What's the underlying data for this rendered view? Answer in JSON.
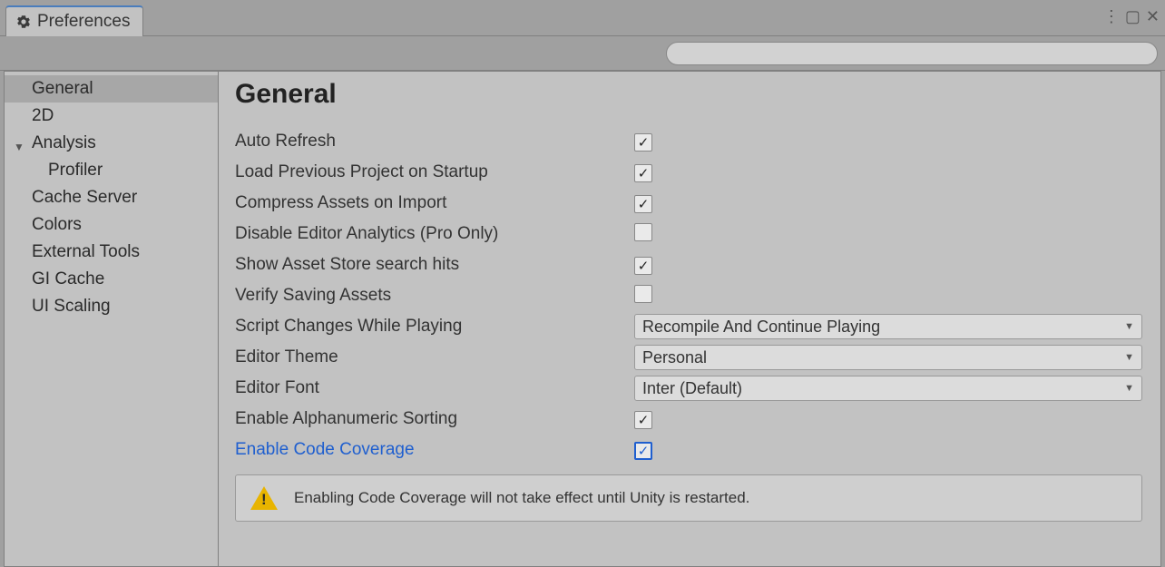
{
  "window": {
    "tab_title": "Preferences"
  },
  "sidebar": {
    "items": [
      {
        "label": "General",
        "selected": true
      },
      {
        "label": "2D"
      },
      {
        "label": "Analysis",
        "expandable": true
      },
      {
        "label": "Profiler",
        "child": true
      },
      {
        "label": "Cache Server"
      },
      {
        "label": "Colors"
      },
      {
        "label": "External Tools"
      },
      {
        "label": "GI Cache"
      },
      {
        "label": "UI Scaling"
      }
    ]
  },
  "content": {
    "heading": "General",
    "prefs": [
      {
        "label": "Auto Refresh",
        "type": "checkbox",
        "checked": true
      },
      {
        "label": "Load Previous Project on Startup",
        "type": "checkbox",
        "checked": true
      },
      {
        "label": "Compress Assets on Import",
        "type": "checkbox",
        "checked": true
      },
      {
        "label": "Disable Editor Analytics (Pro Only)",
        "type": "checkbox",
        "checked": false
      },
      {
        "label": "Show Asset Store search hits",
        "type": "checkbox",
        "checked": true
      },
      {
        "label": "Verify Saving Assets",
        "type": "checkbox",
        "checked": false
      },
      {
        "label": "Script Changes While Playing",
        "type": "dropdown",
        "value": "Recompile And Continue Playing"
      },
      {
        "label": "Editor Theme",
        "type": "dropdown",
        "value": "Personal"
      },
      {
        "label": "Editor Font",
        "type": "dropdown",
        "value": "Inter (Default)"
      },
      {
        "label": "Enable Alphanumeric Sorting",
        "type": "checkbox",
        "checked": true
      },
      {
        "label": "Enable Code Coverage",
        "type": "checkbox",
        "checked": true,
        "highlight": true
      }
    ],
    "info": "Enabling Code Coverage will not take effect until Unity is restarted."
  },
  "search": {
    "placeholder": ""
  }
}
